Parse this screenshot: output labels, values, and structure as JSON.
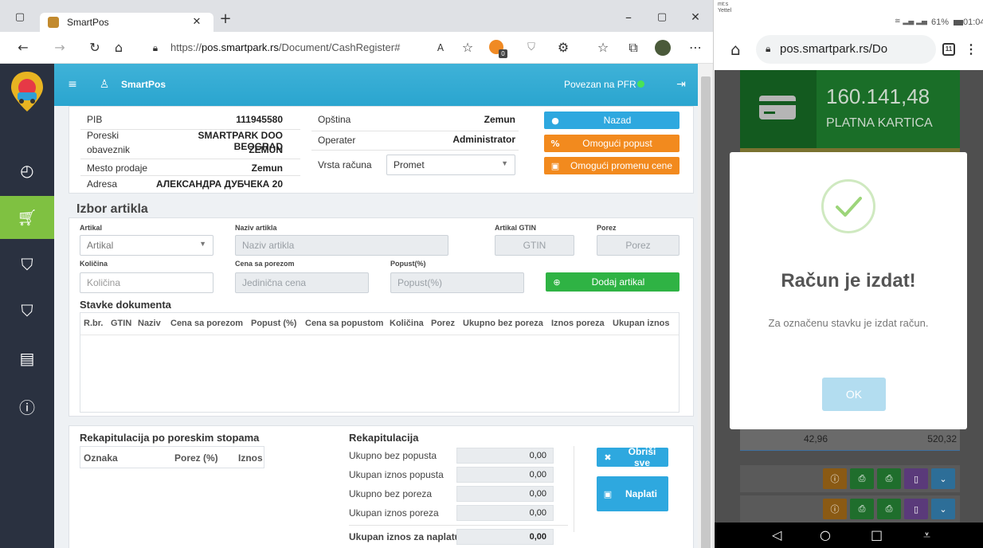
{
  "browser": {
    "tab_title": "SmartPos",
    "url_prefix": "https://",
    "url_host": "pos.smartpark.rs",
    "url_path": "/Document/CashRegister#",
    "extension_badge": "0"
  },
  "app": {
    "brand": "SmartPos",
    "pfr_status": "Povezan na PFR"
  },
  "info": {
    "pib_label": "PIB",
    "pib_value": "111945580",
    "poreski_label": "Poreski",
    "poreski_value": "SMARTPARK DOO BEOGRAD",
    "obveznik_label": "obaveznik",
    "obveznik_value": "ZEMUN",
    "mesto_label": "Mesto prodaje",
    "mesto_value": "Zemun",
    "adresa_label": "Adresa",
    "adresa_value": "АЛЕКСАНДРА ДУБЧЕКА 20",
    "opstina_label": "Opština",
    "opstina_value": "Zemun",
    "operater_label": "Operater",
    "operater_value": "Administrator",
    "vrsta_label": "Vrsta računa",
    "vrsta_value": "Promet"
  },
  "actions": {
    "nazad": "Nazad",
    "popust": "Omogući popust",
    "promena_cene": "Omogući promenu cene"
  },
  "izbor": {
    "title": "Izbor artikla",
    "artikal_label": "Artikal",
    "artikal_value": "Artikal",
    "naziv_label": "Naziv artikla",
    "naziv_placeholder": "Naziv artikla",
    "gtin_label": "Artikal GTIN",
    "gtin_placeholder": "GTIN",
    "porez_label": "Porez",
    "porez_placeholder": "Porez",
    "kolicina_label": "Količina",
    "kolicina_placeholder": "Količina",
    "cena_label": "Cena sa porezom",
    "cena_placeholder": "Jedinična cena",
    "popust_label": "Popust(%)",
    "popust_placeholder": "Popust(%)",
    "dodaj": "Dodaj artikal"
  },
  "stavke": {
    "title": "Stavke dokumenta",
    "columns": [
      "R.br.",
      "GTIN",
      "Naziv",
      "Cena sa porezom",
      "Popust (%)",
      "Cena sa popustom",
      "Količina",
      "Porez",
      "Ukupno bez poreza",
      "Iznos poreza",
      "Ukupan iznos"
    ]
  },
  "rekap_stope": {
    "title": "Rekapitulacija po poreskim stopama",
    "columns": [
      "Oznaka",
      "Porez (%)",
      "Iznos"
    ]
  },
  "rekap": {
    "title": "Rekapitulacija",
    "rows": [
      {
        "label": "Ukupno bez popusta",
        "value": "0,00"
      },
      {
        "label": "Ukupan iznos popusta",
        "value": "0,00"
      },
      {
        "label": "Ukupno bez poreza",
        "value": "0,00"
      },
      {
        "label": "Ukupan iznos poreza",
        "value": "0,00"
      }
    ],
    "total_label": "Ukupan iznos za naplatu",
    "total_value": "0,00",
    "obrisi": "Obriši sve",
    "naplati": "Naplati"
  },
  "phone": {
    "carrier_line1": "mt:s",
    "carrier_line2": "Yettel",
    "battery": "61%",
    "time": "01:04",
    "url": "pos.smartpark.rs/Do",
    "tabs_count": "11",
    "card_amount": "160.141,48",
    "card_label": "PLATNA KARTICA",
    "modal_title": "Račun je izdat!",
    "modal_text": "Za označenu stavku je izdat račun.",
    "ok": "OK",
    "row_left": "42,96",
    "row_right": "520,32"
  }
}
